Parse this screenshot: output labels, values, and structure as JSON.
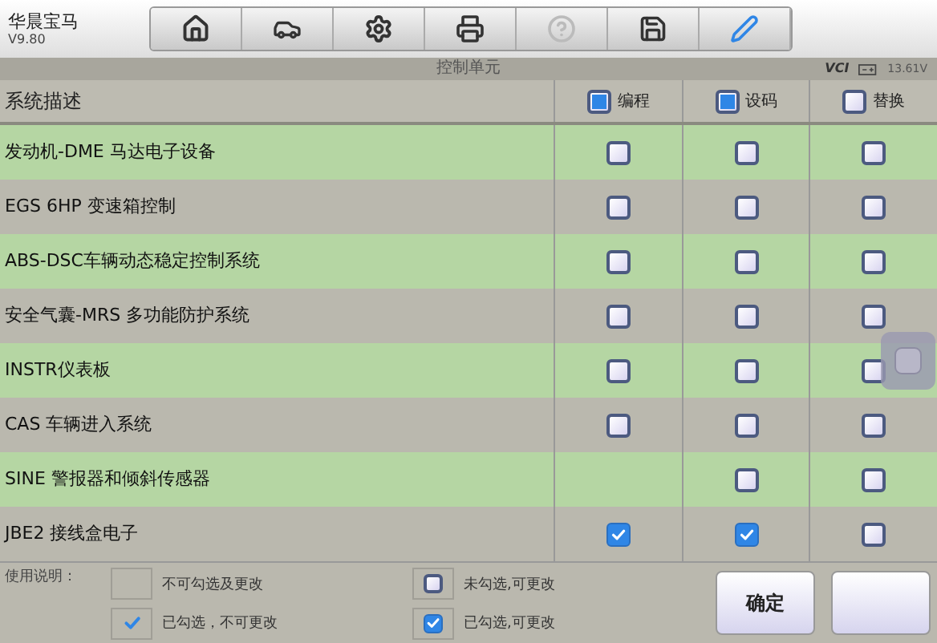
{
  "app": {
    "title": "华晨宝马",
    "version": "V9.80"
  },
  "toolbar": [
    {
      "kind": "home",
      "disabled": false
    },
    {
      "kind": "lift",
      "disabled": false
    },
    {
      "kind": "settings",
      "disabled": false
    },
    {
      "kind": "print",
      "disabled": false
    },
    {
      "kind": "help",
      "disabled": true
    },
    {
      "kind": "save",
      "disabled": false
    },
    {
      "kind": "pen",
      "disabled": false
    }
  ],
  "title_bar": {
    "title": "控制单元",
    "vci": "VCI",
    "voltage": "13.61V"
  },
  "table": {
    "columns": [
      {
        "label": "系统描述"
      },
      {
        "label": "编程",
        "checked": true
      },
      {
        "label": "设码",
        "checked": true
      },
      {
        "label": "替换",
        "checked": false
      }
    ],
    "rows": [
      {
        "name": "发动机-DME 马达电子设备",
        "cells": [
          {
            "kind": "box",
            "checked": false
          },
          {
            "kind": "box",
            "checked": false
          },
          {
            "kind": "box",
            "checked": false
          }
        ]
      },
      {
        "name": "EGS 6HP 变速箱控制",
        "cells": [
          {
            "kind": "box",
            "checked": false
          },
          {
            "kind": "box",
            "checked": false
          },
          {
            "kind": "box",
            "checked": false
          }
        ]
      },
      {
        "name": "ABS-DSC车辆动态稳定控制系统",
        "cells": [
          {
            "kind": "box",
            "checked": false
          },
          {
            "kind": "box",
            "checked": false
          },
          {
            "kind": "box",
            "checked": false
          }
        ]
      },
      {
        "name": "安全气囊-MRS 多功能防护系统",
        "cells": [
          {
            "kind": "box",
            "checked": false
          },
          {
            "kind": "box",
            "checked": false
          },
          {
            "kind": "box",
            "checked": false
          }
        ]
      },
      {
        "name": "INSTR仪表板",
        "cells": [
          {
            "kind": "box",
            "checked": false
          },
          {
            "kind": "box",
            "checked": false
          },
          {
            "kind": "box",
            "checked": false
          }
        ]
      },
      {
        "name": "CAS 车辆进入系统",
        "cells": [
          {
            "kind": "box",
            "checked": false
          },
          {
            "kind": "box",
            "checked": false
          },
          {
            "kind": "box",
            "checked": false
          }
        ]
      },
      {
        "name": "SINE 警报器和倾斜传感器",
        "cells": [
          {
            "kind": "none"
          },
          {
            "kind": "box",
            "checked": false
          },
          {
            "kind": "box",
            "checked": false
          }
        ]
      },
      {
        "name": "JBE2 接线盒电子",
        "cells": [
          {
            "kind": "box",
            "checked": true
          },
          {
            "kind": "box",
            "checked": true
          },
          {
            "kind": "box",
            "checked": false
          }
        ]
      }
    ]
  },
  "legend": {
    "label": "使用说明：",
    "items": [
      {
        "kind": "none",
        "text": "不可勾选及更改"
      },
      {
        "kind": "box",
        "checked": false,
        "text": "未勾选,可更改"
      },
      {
        "kind": "tick",
        "checked": true,
        "text": "已勾选，不可更改"
      },
      {
        "kind": "box",
        "checked": true,
        "text": "已勾选,可更改"
      }
    ]
  },
  "buttons": [
    {
      "kind": "text",
      "label": "确定"
    },
    {
      "kind": "blank"
    }
  ]
}
